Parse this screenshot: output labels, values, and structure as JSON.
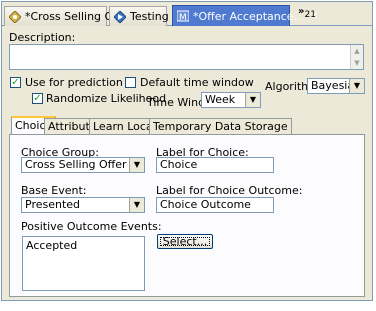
{
  "tabs": [
    {
      "label": "*Cross Selling Offer",
      "icon": "offer-icon"
    },
    {
      "label": "Testing",
      "icon": "testing-icon"
    },
    {
      "label": "*Offer Acceptance...",
      "icon": "model-icon",
      "active": true
    }
  ],
  "overflow": {
    "symbol": "»",
    "count": "21"
  },
  "description": {
    "label": "Description:"
  },
  "use_for_prediction": {
    "label": "Use for prediction",
    "checked": true
  },
  "default_time_window": {
    "label": "Default time window",
    "checked": false
  },
  "algorithm": {
    "label": "Algorithm:",
    "value": "Bayesian"
  },
  "randomize": {
    "label": "Randomize Likelihood",
    "checked": true
  },
  "time_window": {
    "label": "Time Window:",
    "value": "Week"
  },
  "inner_tabs": [
    "Choice",
    "Attributes",
    "Learn Location",
    "Temporary Data Storage"
  ],
  "choice": {
    "group_label": "Choice Group:",
    "group_value": "Cross Selling Offer",
    "label_for_choice_label": "Label for Choice:",
    "label_for_choice_value": "Choice",
    "base_event_label": "Base Event:",
    "base_event_value": "Presented",
    "outcome_label": "Label for Choice Outcome:",
    "outcome_value": "Choice Outcome",
    "positive_label": "Positive Outcome Events:",
    "positive_items": [
      "Accepted"
    ],
    "select_button": "Select..."
  }
}
